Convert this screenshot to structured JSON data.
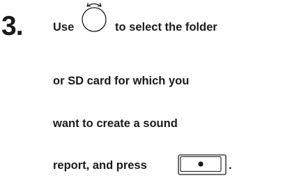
{
  "step": {
    "number": "3.",
    "line1_before": "Use",
    "line1_after": "to select the folder",
    "line2": "or SD card for which you",
    "line3": "want to create a sound",
    "line4_before": "report, and press",
    "line4_end": "."
  },
  "icons": {
    "dial": "rotary-dial-icon",
    "button": "rec-button-icon"
  }
}
